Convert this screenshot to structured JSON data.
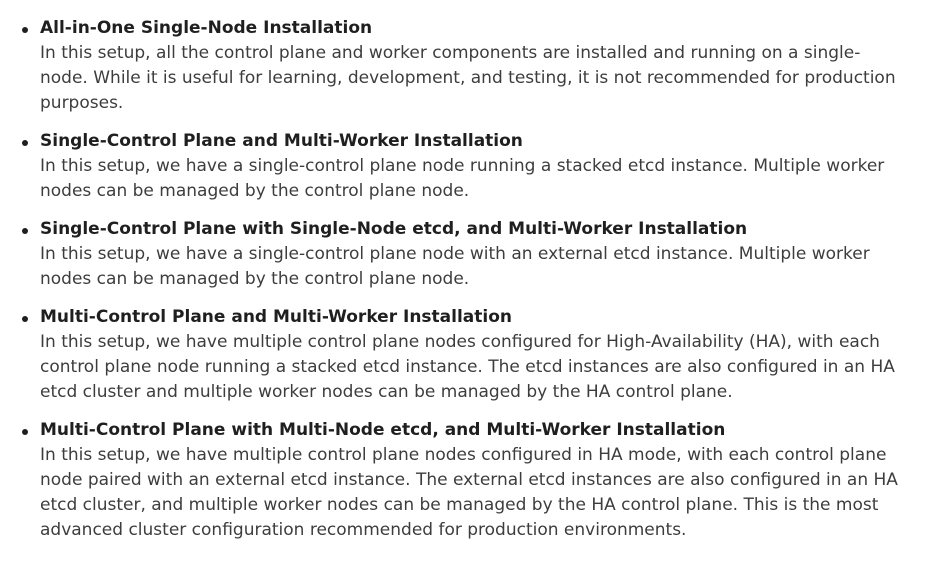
{
  "items": [
    {
      "title": "All-in-One Single-Node Installation",
      "description_lines": [
        "In this setup, all the control plane and worker components are installed and running on a single-",
        "node. While it is useful for learning, development, and testing, it is not recommended for production",
        "purposes."
      ]
    },
    {
      "title": "Single-Control Plane and Multi-Worker Installation",
      "description_lines": [
        "In this setup, we have a single-control plane node running a stacked etcd instance. Multiple worker",
        "nodes can be managed by the control plane node."
      ]
    },
    {
      "title": "Single-Control Plane with Single-Node etcd, and Multi-Worker Installation",
      "description_lines": [
        "In this setup, we have a single-control plane node with an external etcd instance. Multiple worker",
        "nodes can be managed by the control plane node."
      ]
    },
    {
      "title": "Multi-Control Plane and Multi-Worker Installation",
      "description_lines": [
        "In this setup, we have multiple control plane nodes configured for High-Availability (HA), with each",
        "control plane node running a stacked etcd instance. The etcd instances are also configured in an HA",
        "etcd cluster and multiple worker nodes can be managed by the HA control plane."
      ]
    },
    {
      "title": "Multi-Control Plane with Multi-Node etcd, and Multi-Worker Installation",
      "description_lines": [
        "In this setup, we have multiple control plane nodes configured in HA mode, with each control plane",
        "node paired with an external etcd instance. The external etcd instances are also configured in an HA",
        "etcd cluster, and multiple worker nodes can be managed by the HA control plane. This is the most",
        "advanced cluster configuration recommended for production environments."
      ]
    }
  ]
}
